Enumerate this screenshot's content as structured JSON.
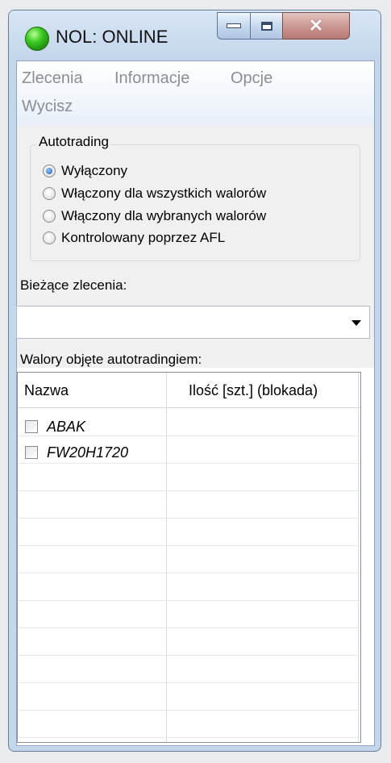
{
  "window": {
    "title": "NOL: ONLINE",
    "status_color": "#3ecb23"
  },
  "menu": {
    "items": [
      "Zlecenia",
      "Informacje",
      "Opcje",
      "Wycisz"
    ]
  },
  "autotrading": {
    "group_label": "Autotrading",
    "options": [
      {
        "label": "Wyłączony",
        "checked": true
      },
      {
        "label": "Włączony dla wszystkich walorów",
        "checked": false
      },
      {
        "label": "Włączony dla wybranych walorów",
        "checked": false
      },
      {
        "label": "Kontrolowany poprzez AFL",
        "checked": false
      }
    ]
  },
  "orders": {
    "label": "Bieżące zlecenia:",
    "selected_value": ""
  },
  "securities": {
    "label": "Walory objęte autotradingiem:",
    "columns": [
      "Nazwa",
      "Ilość [szt.] (blokada)"
    ],
    "rows": [
      {
        "name": "ABAK",
        "quantity": "",
        "checked": false
      },
      {
        "name": "FW20H1720",
        "quantity": "",
        "checked": false
      }
    ]
  }
}
